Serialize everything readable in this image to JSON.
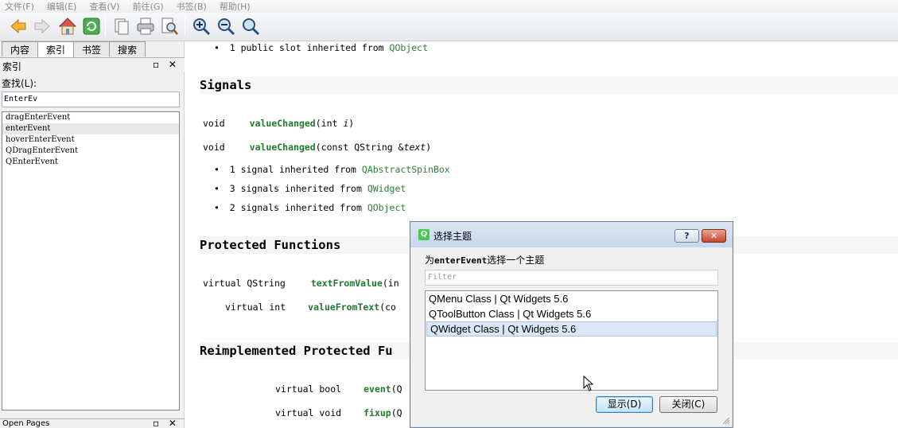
{
  "menubar": [
    "文件(F)",
    "编辑(E)",
    "查看(V)",
    "前往(G)",
    "书签(B)",
    "帮助(H)"
  ],
  "left": {
    "tabs": [
      "内容",
      "索引",
      "书签",
      "搜索"
    ],
    "dock_title": "索引",
    "dock_buttons": "▫ ✕",
    "find_label": "查找(L):",
    "find_value": "EnterEv",
    "items": [
      "dragEnterEvent",
      "enterEvent",
      "hoverEnterEvent",
      "QDragEnterEvent",
      "QEnterEvent"
    ],
    "open_pages": "Open Pages"
  },
  "content": {
    "slot_line": {
      "text": "1 public slot inherited from ",
      "link": "QObject"
    },
    "signals_heading": "Signals",
    "sig1": {
      "ret": "void",
      "name": "valueChanged",
      "args": "(int ",
      "param": "i",
      "close": ")"
    },
    "sig2": {
      "ret": "void",
      "name": "valueChanged",
      "args": "(const QString &",
      "param": "text",
      "close": ")"
    },
    "inherited": [
      {
        "text": "1 signal inherited from ",
        "link": "QAbstractSpinBox"
      },
      {
        "text": "3 signals inherited from ",
        "link": "QWidget"
      },
      {
        "text": "2 signals inherited from ",
        "link": "QObject"
      }
    ],
    "protected_heading": "Protected Functions",
    "prot1": {
      "ret": "virtual QString",
      "name": "textFromValue",
      "rest": "(in"
    },
    "prot2": {
      "ret": "virtual int",
      "name": "valueFromText",
      "rest": "(co"
    },
    "reimpl_heading": "Reimplemented Protected Fu",
    "reimpl1": {
      "ret": "virtual bool",
      "name": "event",
      "rest": "(Q"
    },
    "reimpl2": {
      "ret": "virtual void",
      "name": "fixup",
      "rest": "(Q"
    }
  },
  "dialog": {
    "title": "选择主题",
    "icon": "Q",
    "help": "?",
    "close": "✕",
    "prompt_pre": "为",
    "prompt_bold": "enterEvent",
    "prompt_post": "选择一个主题",
    "filter_placeholder": "Filter",
    "topics": [
      "QMenu Class | Qt Widgets 5.6",
      "QToolButton Class | Qt Widgets 5.6",
      "QWidget Class | Qt Widgets 5.6"
    ],
    "show_label": "显示(D)",
    "close_label": "关闭(C)"
  },
  "colors": {
    "link": "#2e7d3a",
    "function": "#1f7a2c",
    "qt_green": "#41cd52"
  }
}
